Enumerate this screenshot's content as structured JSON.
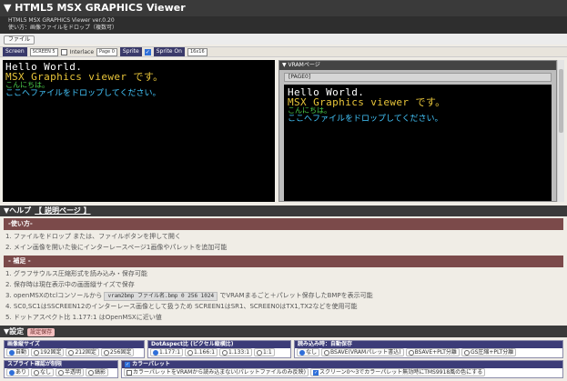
{
  "app": {
    "title": "HTML5 MSX GRAPHICS Viewer",
    "version": "HTML5 MSX GRAPHICS Viewer ver.0.20",
    "usage": "使い方：画像ファイルをドロップ（複数可）"
  },
  "file_button": "ファイル",
  "screenbar": {
    "screen_label": "Screen",
    "screen_value": "SCREEN 5",
    "interlace_label": "Interlace",
    "interlace_checked": false,
    "page_value": "Page 0",
    "sprite_label": "Sprite",
    "sprite_on_label": "Sprite On",
    "sprite_on_checked": true,
    "sprite_size": "16x16"
  },
  "screen_text": {
    "line1": "Hello World.",
    "line2": "MSX Graphics viewer です。",
    "line3": "こんにちは。",
    "line4": "ここへファイルをドロップしてください。"
  },
  "vram": {
    "header": "▼ VRAMページ",
    "page_label": "[PAGE0]"
  },
  "help": {
    "title": "▼ヘルプ",
    "link": "【 説明ページ 】",
    "usage_header": "-使い方-",
    "usage_items": [
      "1. ファイルをドロップ または、ファイルボタンを押して開く",
      "2. メイン画像を開いた後にインターレースページ1画像やパレットを追加可能"
    ],
    "notes_header": "- 補足 -",
    "notes": {
      "n1": "1. グラフサウルス圧縮形式を読み込み・保存可能",
      "n2": "2. 保存時は現在表示中の画面縦サイズで保存",
      "n3_pre": "3. openMSXのtclコンソールから",
      "n3_code": "vram2bmp ファイル名.bmp 0 256 1024",
      "n3_post": "でVRAMまるごと＋パレット保存したBMPを表示可能",
      "n4": "4. SC0,SC1はSSCREEN12のインターレース画像として扱うため SCREEN1はSR1、SCREEN0はTX1,TX2などを使用可能",
      "n5": "5. ドットアスペクト比 1.177:1 はOpenMSXに近い値"
    }
  },
  "settings": {
    "title": "▼設定",
    "save_button": "設定保存",
    "image_size": {
      "header": "画像縦サイズ",
      "options": [
        "自動",
        "192固定",
        "212固定",
        "256固定"
      ],
      "selected": "自動"
    },
    "dot_aspect": {
      "header": "DotAspect比 (ピクセル縦横比)",
      "options": [
        "1.177:1",
        "1.166:1",
        "1.133:1",
        "1:1"
      ],
      "selected": "1.177:1"
    },
    "load_save": {
      "header": "読み込み時：自動保存",
      "options": [
        "なし",
        "BSAVE(VRAMパレット書込)",
        "BSAVE+PLT分離",
        "GS圧縮+PLT分離"
      ],
      "selected": "なし"
    },
    "sprite_trans": {
      "header": "スプライト確認が制限",
      "options": [
        "あり",
        "なし",
        "半透明",
        "縞影"
      ],
      "selected": "あり"
    },
    "color_palette": {
      "header": "カラーパレット",
      "checked": true,
      "opt1": "カラーパレットをVRAMから読み込まない(パレットファイルのみ反映)",
      "opt1_checked": false,
      "opt2": "スクリーン0〜3でカラーパレット無効時にTMS9918風の色にする",
      "opt2_checked": true
    }
  }
}
